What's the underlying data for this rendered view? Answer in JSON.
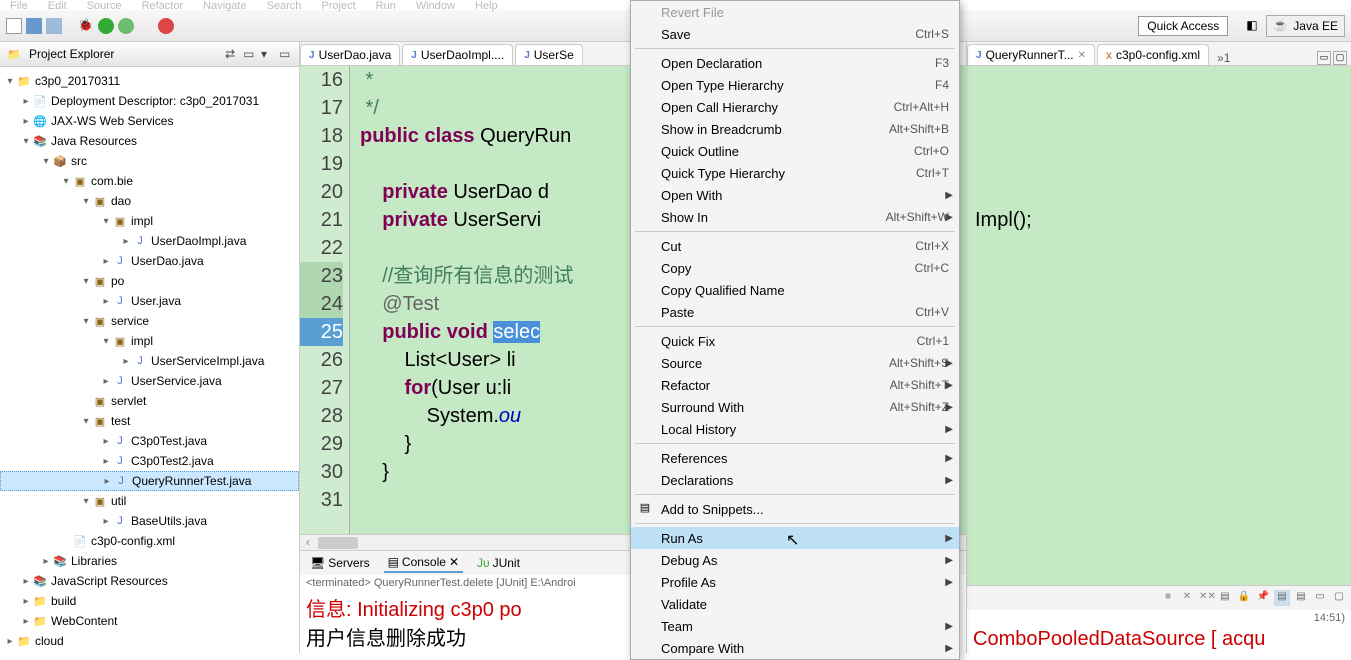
{
  "menubar": [
    "File",
    "Edit",
    "Source",
    "Refactor",
    "Navigate",
    "Search",
    "Project",
    "Run",
    "Window",
    "Help"
  ],
  "quick_access": "Quick Access",
  "perspective": "Java EE",
  "explorer": {
    "title": "Project Explorer",
    "tree": {
      "project": "c3p0_20170311",
      "dd": "Deployment Descriptor: c3p0_2017031",
      "jaxws": "JAX-WS Web Services",
      "javares": "Java Resources",
      "src": "src",
      "pkg": "com.bie",
      "dao": "dao",
      "dao_impl": "impl",
      "dao_impl_file": "UserDaoImpl.java",
      "dao_file": "UserDao.java",
      "po": "po",
      "po_file": "User.java",
      "service": "service",
      "service_impl": "impl",
      "service_impl_file": "UserServiceImpl.java",
      "service_file": "UserService.java",
      "servlet": "servlet",
      "test": "test",
      "test_f1": "C3p0Test.java",
      "test_f2": "C3p0Test2.java",
      "test_f3": "QueryRunnerTest.java",
      "util": "util",
      "util_file": "BaseUtils.java",
      "config": "c3p0-config.xml",
      "libraries": "Libraries",
      "jsres": "JavaScript Resources",
      "build": "build",
      "webcontent": "WebContent",
      "cloud": "cloud"
    }
  },
  "tabs": {
    "t1": "UserDao.java",
    "t2": "UserDaoImpl....",
    "t3": "UserSe",
    "tr1": "QueryRunnerT...",
    "tr2": "c3p0-config.xml",
    "more": "»1"
  },
  "code": {
    "lines": [
      "16",
      "17",
      "18",
      "19",
      "20",
      "21",
      "22",
      "23",
      "24",
      "25",
      "26",
      "27",
      "28",
      "29",
      "30",
      "31"
    ],
    "l16": " *",
    "l17": " */",
    "l18_a": "public",
    "l18_b": "class",
    "l18_c": " QueryRun",
    "l19": "",
    "l20_a": "    private",
    "l20_b": " UserDao d",
    "l21_a": "    private",
    "l21_b": " UserServi",
    "l22": "",
    "l23_a": "    //",
    "l23_b": "查询所有信息的测试",
    "l24": "    @Test",
    "l25_a": "    public",
    "l25_b": "void",
    "l25_c": "selec",
    "l26": "        List<User> li",
    "l27_a": "        for",
    "l27_b": "(User u:li",
    "l28_a": "            System.",
    "l28_b": "ou",
    "l29": "        }",
    "l30": "    }",
    "right_text": "Impl();"
  },
  "console": {
    "tab_servers": "Servers",
    "tab_console": "Console",
    "tab_junit": "JUnit",
    "header": "<terminated> QueryRunnerTest.delete [JUnit] E:\\Androi",
    "header_right": "14:51)",
    "line1_red": "信息: Initializing c3p0 po",
    "line1_red_right": "ComboPooledDataSource [ acqu",
    "line2": "用户信息删除成功"
  },
  "ctx": {
    "revert": "Revert File",
    "save": "Save",
    "save_sc": "Ctrl+S",
    "opendecl": "Open Declaration",
    "opendecl_sc": "F3",
    "opentype": "Open Type Hierarchy",
    "opentype_sc": "F4",
    "opencall": "Open Call Hierarchy",
    "opencall_sc": "Ctrl+Alt+H",
    "breadcrumb": "Show in Breadcrumb",
    "breadcrumb_sc": "Alt+Shift+B",
    "qoutline": "Quick Outline",
    "qoutline_sc": "Ctrl+O",
    "qtype": "Quick Type Hierarchy",
    "qtype_sc": "Ctrl+T",
    "openwith": "Open With",
    "showin": "Show In",
    "showin_sc": "Alt+Shift+W",
    "cut": "Cut",
    "cut_sc": "Ctrl+X",
    "copy": "Copy",
    "copy_sc": "Ctrl+C",
    "copyq": "Copy Qualified Name",
    "paste": "Paste",
    "paste_sc": "Ctrl+V",
    "qfix": "Quick Fix",
    "qfix_sc": "Ctrl+1",
    "source": "Source",
    "source_sc": "Alt+Shift+S",
    "refactor": "Refactor",
    "refactor_sc": "Alt+Shift+T",
    "surround": "Surround With",
    "surround_sc": "Alt+Shift+Z",
    "localhist": "Local History",
    "refs": "References",
    "decls": "Declarations",
    "snippets": "Add to Snippets...",
    "runas": "Run As",
    "debugas": "Debug As",
    "profileas": "Profile As",
    "validate": "Validate",
    "team": "Team",
    "compare": "Compare With"
  }
}
